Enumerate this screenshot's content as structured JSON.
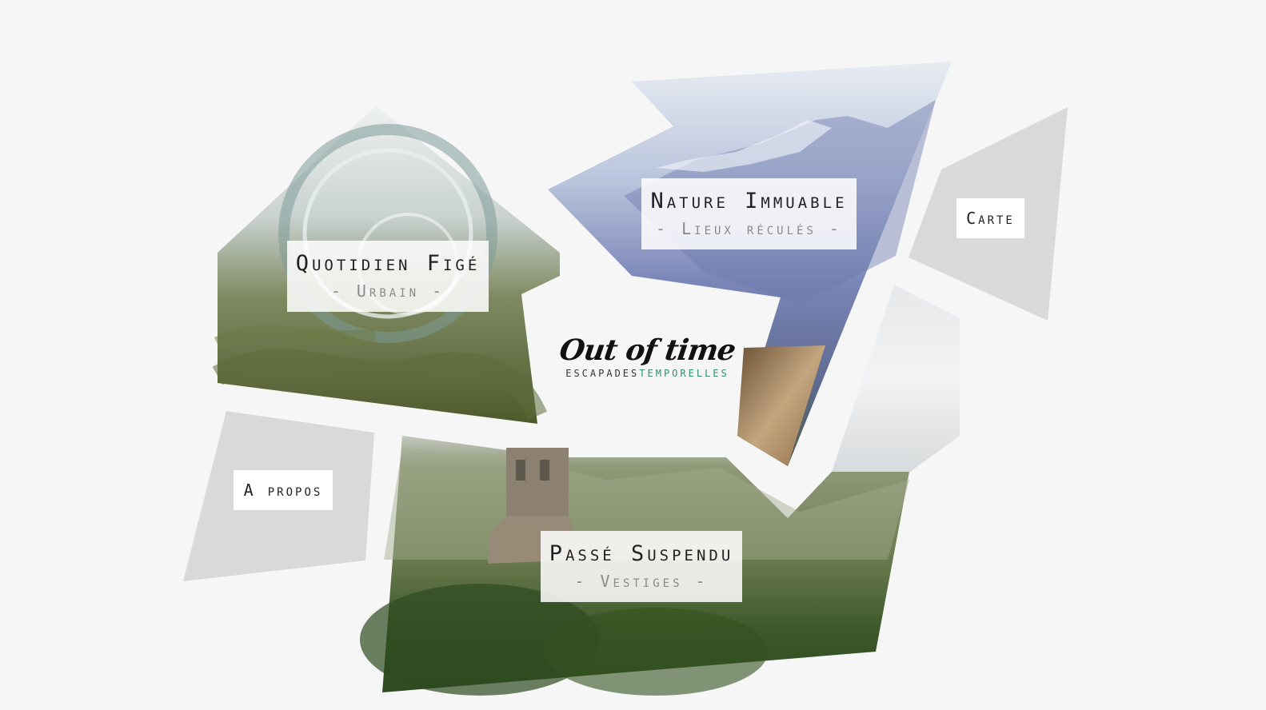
{
  "brand": {
    "name": "Out of time",
    "tagline_a": "ESCAPADES",
    "tagline_b": "TEMPORELLES"
  },
  "tiles": {
    "urbain": {
      "title": "Quotidien Figé",
      "subtitle": "- Urbain -"
    },
    "nature": {
      "title": "Nature Immuable",
      "subtitle": "- Lieux réculés -"
    },
    "vestiges": {
      "title": "Passé Suspendu",
      "subtitle": "- Vestiges -"
    }
  },
  "nav": {
    "carte": "Carte",
    "apropos": "A propos"
  },
  "colors": {
    "background": "#f6f6f6",
    "grey_tile": "#d9d9d9",
    "accent": "#2f8f6e"
  },
  "icons": {
    "urbain_image": "rollercoaster-photo",
    "nature_image": "mountain-photo",
    "vestiges_image": "tower-hills-photo"
  }
}
